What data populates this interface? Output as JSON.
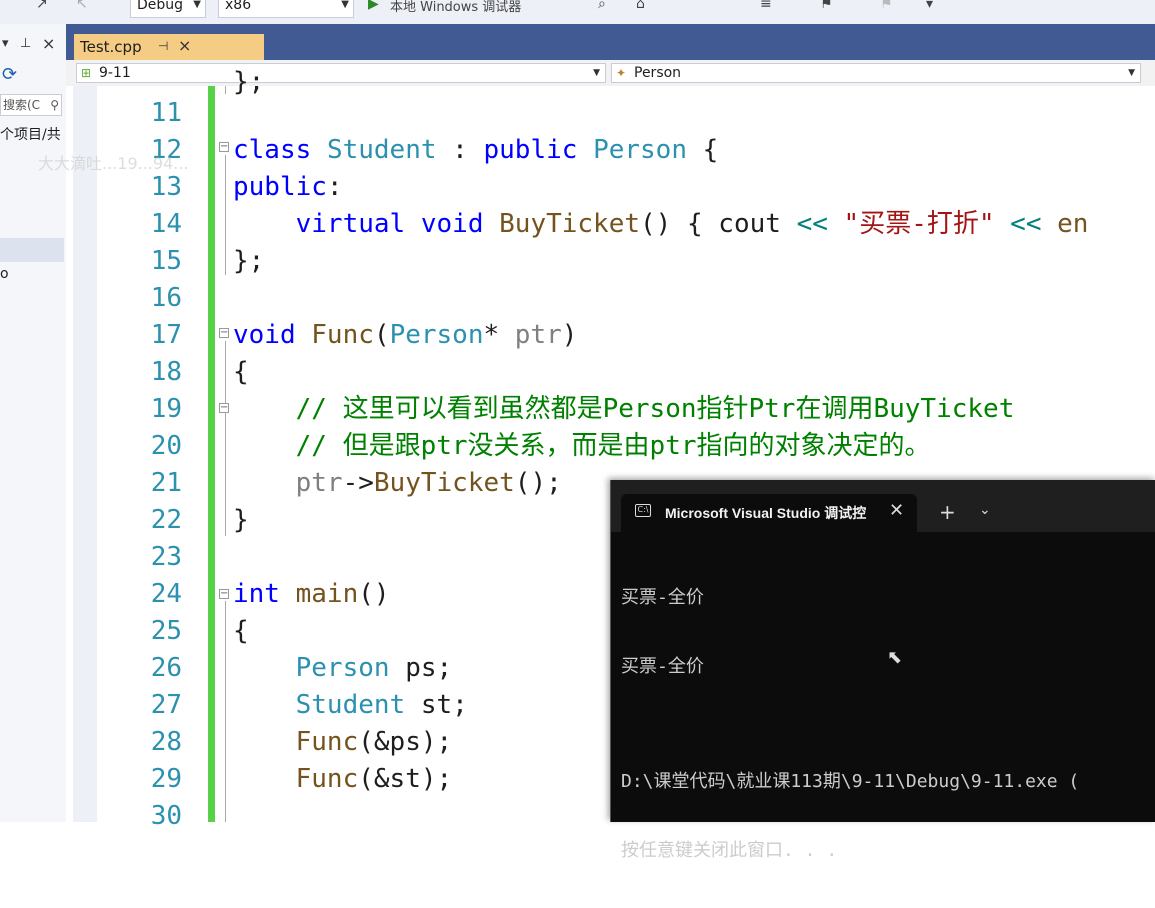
{
  "toolbar": {
    "config": "Debug",
    "platform": "x86",
    "run_label": "本地 Windows 调试器"
  },
  "left_panel": {
    "search_placeholder": "搜索(C",
    "text_a": "个项目/共",
    "text_b": "o"
  },
  "tab": {
    "label": "Test.cpp",
    "pin": "⊣",
    "close": "×"
  },
  "nav": {
    "project": "9-11",
    "scope": "Person"
  },
  "watermark": "大大滴吐...19...94...",
  "editor": {
    "line_numbers": [
      "11",
      "12",
      "13",
      "14",
      "15",
      "16",
      "17",
      "18",
      "19",
      "20",
      "21",
      "22",
      "23",
      "24",
      "25",
      "26",
      "27",
      "28",
      "29",
      "30"
    ],
    "comment1": "// 这里可以看到虽然都是Person指针Ptr在调用BuyTicket",
    "comment2": "// 但是跟ptr没关系，而是由ptr指向的对象决定的。",
    "string1": "\"买票-打折\""
  },
  "console": {
    "title": "Microsoft Visual Studio 调试控",
    "lines": [
      "买票-全价",
      "买票-全价",
      "",
      "D:\\课堂代码\\就业课113期\\9-11\\Debug\\9-11.exe (",
      "按任意键关闭此窗口. . ."
    ]
  }
}
